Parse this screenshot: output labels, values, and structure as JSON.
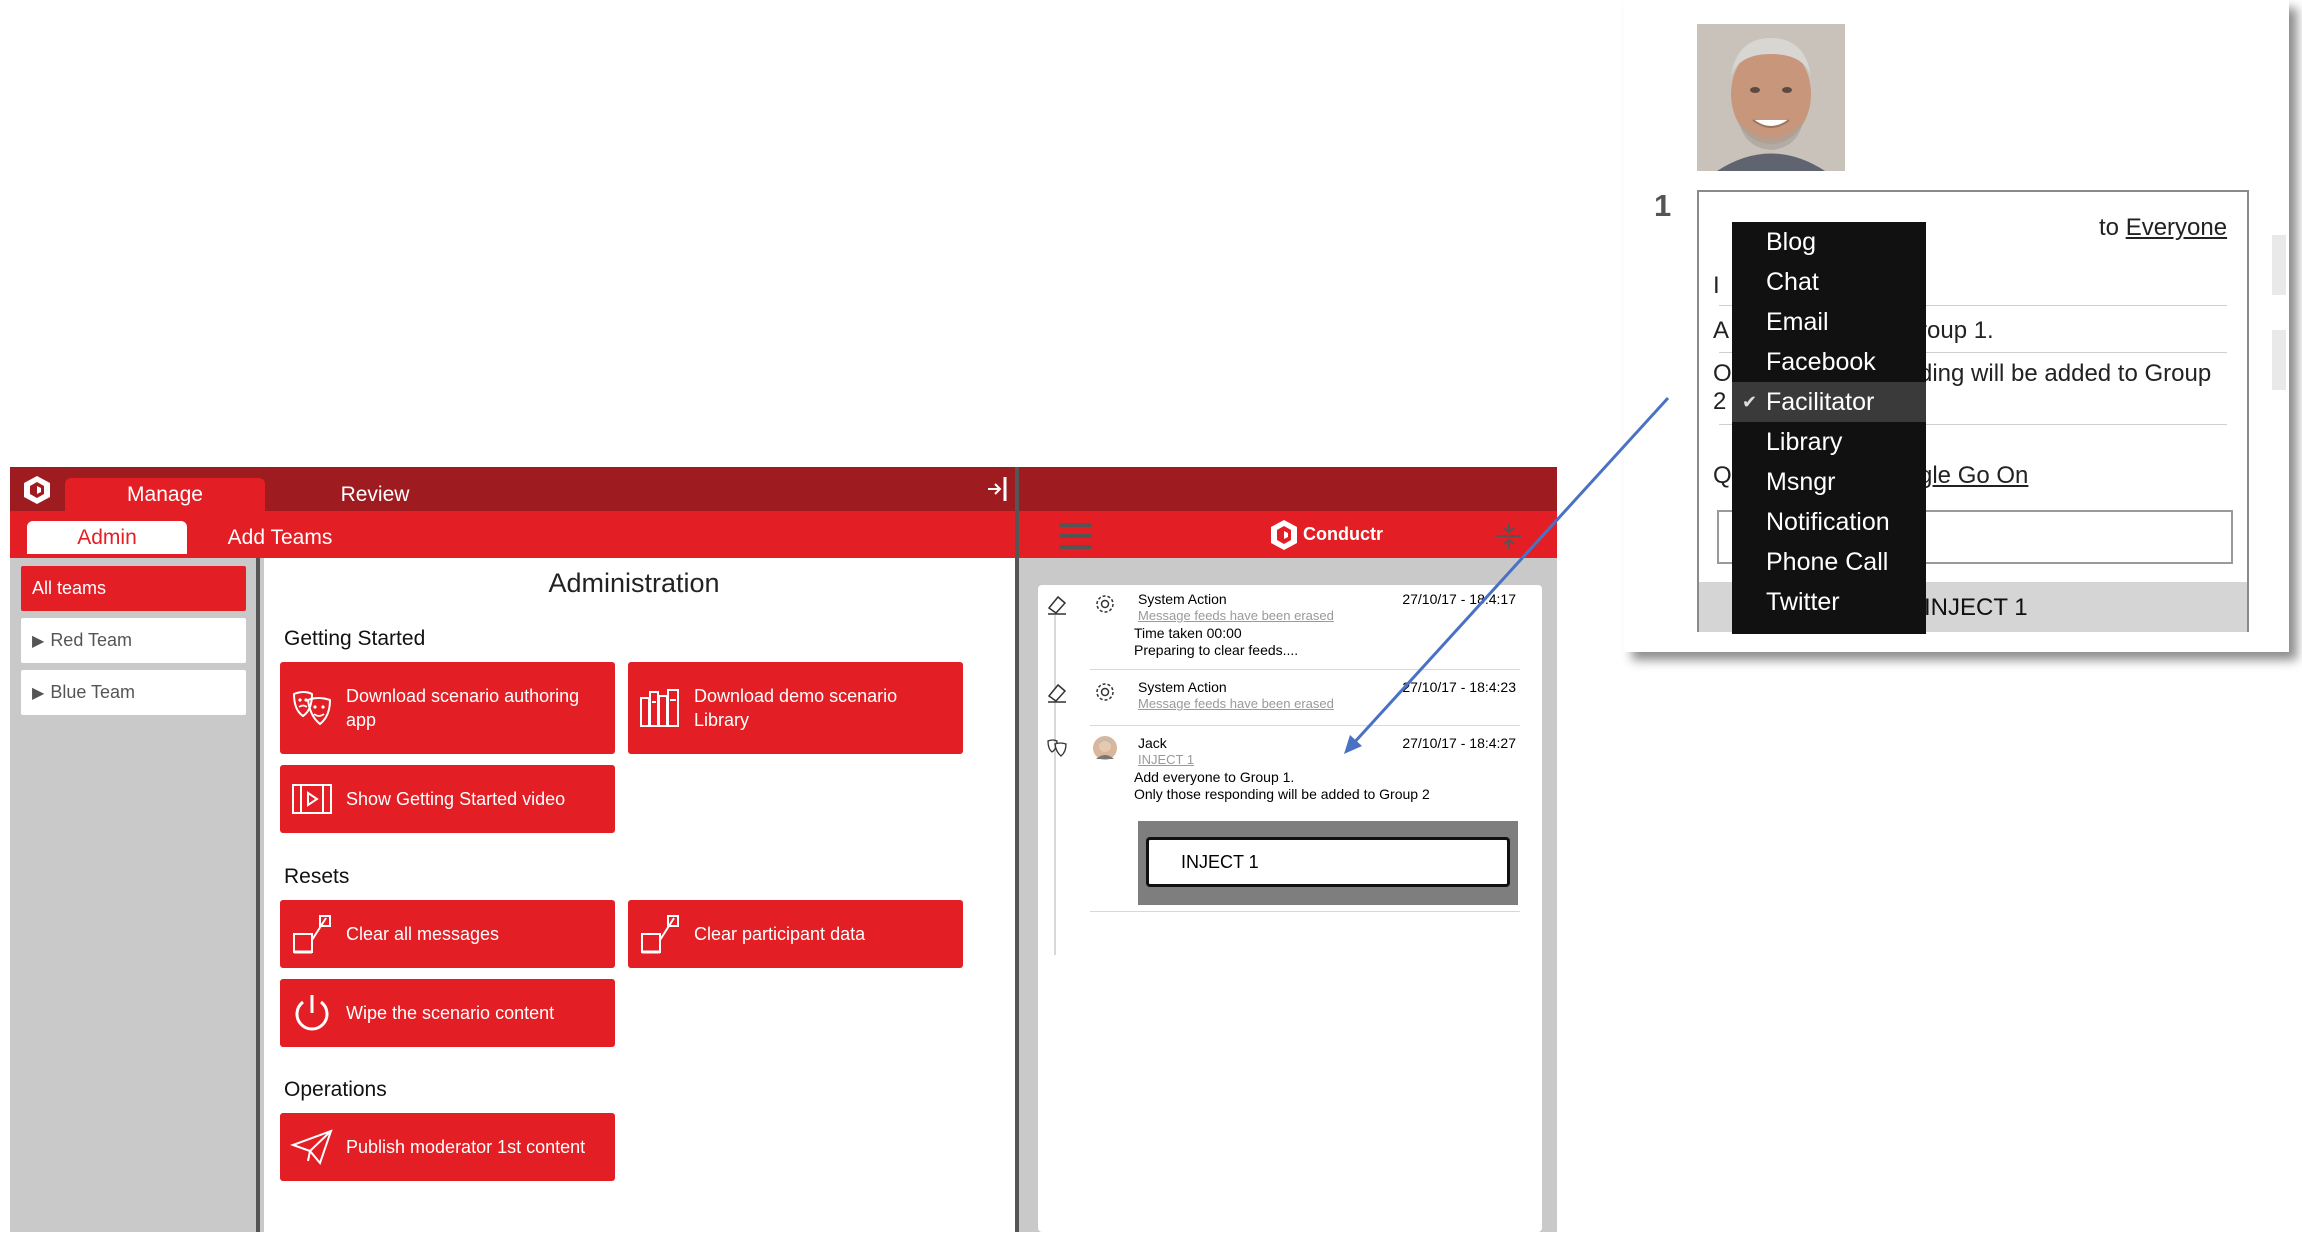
{
  "topbar": {
    "tabs": [
      "Manage",
      "Review"
    ]
  },
  "subbar": {
    "tabs": [
      "Admin",
      "Add Teams"
    ]
  },
  "sidebar": {
    "teams": [
      "All teams",
      "Red Team",
      "Blue Team"
    ]
  },
  "content": {
    "title": "Administration",
    "sections": {
      "getting_started": "Getting Started",
      "resets": "Resets",
      "operations": "Operations"
    },
    "buttons": {
      "download_app": "Download scenario authoring app",
      "download_library": "Download demo scenario Library",
      "show_video": "Show Getting Started video",
      "clear_messages": "Clear all messages",
      "clear_participant": "Clear participant data",
      "wipe_content": "Wipe the scenario content",
      "publish_moderator": "Publish moderator 1st content"
    }
  },
  "right_panel": {
    "logo": "Conductr",
    "messages": [
      {
        "sender": "System Action",
        "time": "27/10/17 - 18:4:17",
        "link": "Message feeds have been erased",
        "body": "Time taken 00:00\nPreparing to clear feeds...."
      },
      {
        "sender": "System Action",
        "time": "27/10/17 - 18:4:23",
        "link": "Message feeds have been erased",
        "body": ""
      },
      {
        "sender": "Jack",
        "time": "27/10/17 - 18:4:27",
        "link": "INJECT 1",
        "body": "Add everyone to Group 1.\nOnly those responding will be added to Group 2"
      }
    ],
    "inject_button": "INJECT 1"
  },
  "callout": {
    "number": "1",
    "to_label": "to",
    "to_target": "Everyone",
    "text_fragments": [
      "roup 1.",
      "ding will be added to Group",
      "gle Go On"
    ],
    "left_fragments": [
      "I",
      "A",
      "O",
      "2",
      "Q"
    ],
    "footer_button": "INJECT 1",
    "dropdown_items": [
      "Blog",
      "Chat",
      "Email",
      "Facebook",
      "Facilitator",
      "Library",
      "Msngr",
      "Notification",
      "Phone Call",
      "Twitter"
    ],
    "dropdown_selected": "Facilitator"
  },
  "colors": {
    "brand_red": "#e31e24",
    "dark_red": "#9e1b1f",
    "arrow_blue": "#4a72c4"
  }
}
